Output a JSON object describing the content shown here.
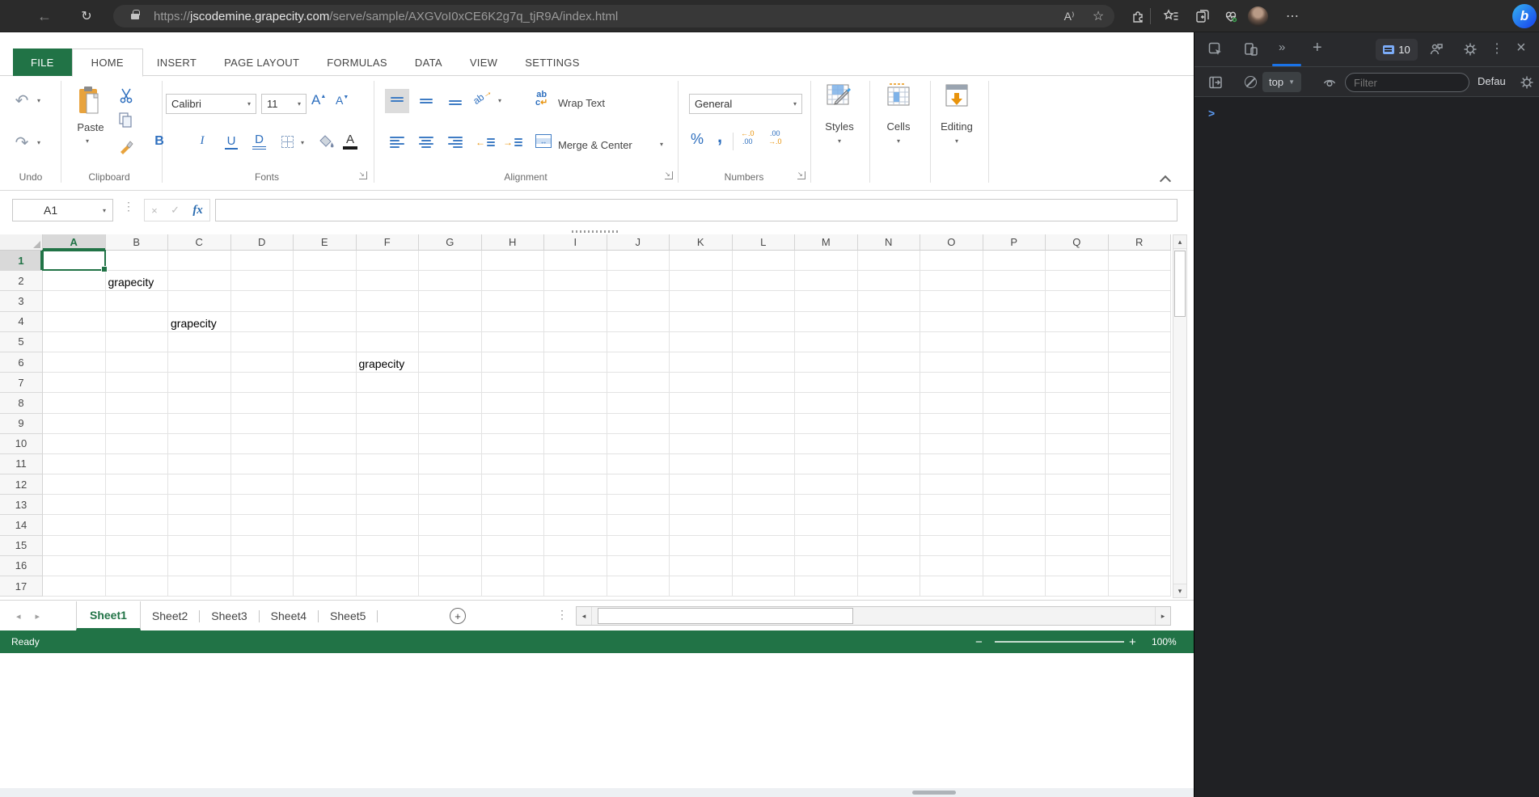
{
  "colors": {
    "excel_green": "#217346",
    "ribbon_icon_blue": "#2e6fbe",
    "accent_orange": "#e8930c",
    "devtools_accent_blue": "#1a73e8",
    "devtools_icon_gray": "#9aa0a6",
    "selection_border": "#217346"
  },
  "browser": {
    "back_icon": "←",
    "refresh_icon": "↻",
    "url": {
      "scheme": "https://",
      "domain": "jscodemine.grapecity.com",
      "path": "/serve/sample/AXGVoI0xCE6K2g7q_tjR9A/index.html"
    },
    "read_aloud_label": "A⁾",
    "favorite_star": "☆",
    "more_label": "⋯",
    "bing_label": "b"
  },
  "ribbon": {
    "tabs": [
      {
        "label": "FILE",
        "state": "file"
      },
      {
        "label": "HOME",
        "state": "active"
      },
      {
        "label": "INSERT",
        "state": "normal"
      },
      {
        "label": "PAGE LAYOUT",
        "state": "normal"
      },
      {
        "label": "FORMULAS",
        "state": "normal"
      },
      {
        "label": "DATA",
        "state": "normal"
      },
      {
        "label": "VIEW",
        "state": "normal"
      },
      {
        "label": "SETTINGS",
        "state": "normal"
      }
    ],
    "undo_icon": "↶",
    "redo_icon": "↷",
    "paste_label": "Paste",
    "font_family_value": "Calibri",
    "font_size_value": "11",
    "grow_font": "A",
    "shrink_font": "A",
    "bold": "B",
    "italic": "I",
    "underline": "U",
    "double_underline": "D",
    "font_color": "A",
    "orientation": "ab",
    "wrap_text_label": "Wrap Text",
    "merge_center_label": "Merge & Center",
    "number_format_value": "General",
    "percent": "%",
    "comma": ",",
    "dec_decimal": "←.0",
    "dec_decimal2": ".00",
    "inc_decimal": ".00",
    "inc_decimal2": "→.0",
    "styles_label": "Styles",
    "cells_label": "Cells",
    "editing_label": "Editing",
    "group_labels": {
      "undo": "Undo",
      "clipboard": "Clipboard",
      "fonts": "Fonts",
      "alignment": "Alignment",
      "numbers": "Numbers"
    }
  },
  "formula_bar": {
    "name_box_value": "A1",
    "cancel_icon": "×",
    "enter_icon": "✓",
    "fx_label": "fx",
    "formula_value": ""
  },
  "grid": {
    "columns": [
      "A",
      "B",
      "C",
      "D",
      "E",
      "F",
      "G",
      "H",
      "I",
      "J",
      "K",
      "L",
      "M",
      "N",
      "O",
      "P",
      "Q",
      "R"
    ],
    "row_count": 17,
    "selected_cell": "A1",
    "selected_col": "A",
    "selected_row": 1,
    "cells": [
      {
        "col": "B",
        "row": 2,
        "value": "grapecity"
      },
      {
        "col": "C",
        "row": 4,
        "value": "grapecity"
      },
      {
        "col": "F",
        "row": 6,
        "value": "grapecity"
      }
    ]
  },
  "sheet_bar": {
    "sheets": [
      {
        "label": "Sheet1",
        "active": true
      },
      {
        "label": "Sheet2",
        "active": false
      },
      {
        "label": "Sheet3",
        "active": false
      },
      {
        "label": "Sheet4",
        "active": false
      },
      {
        "label": "Sheet5",
        "active": false
      }
    ],
    "add_sheet": "+",
    "menu_dots": "⋮"
  },
  "status_bar": {
    "ready_label": "Ready",
    "zoom_value": "100%",
    "zoom_minus": "−",
    "zoom_plus": "+"
  },
  "devtools": {
    "more_tabs_icon": "»",
    "add_tab_icon": "+",
    "message_count": "10",
    "close_icon": "×",
    "menu_dots": "⋮",
    "context_value": "top",
    "filter_placeholder": "Filter",
    "log_level_value": "Defau",
    "console_prompt": ">"
  }
}
